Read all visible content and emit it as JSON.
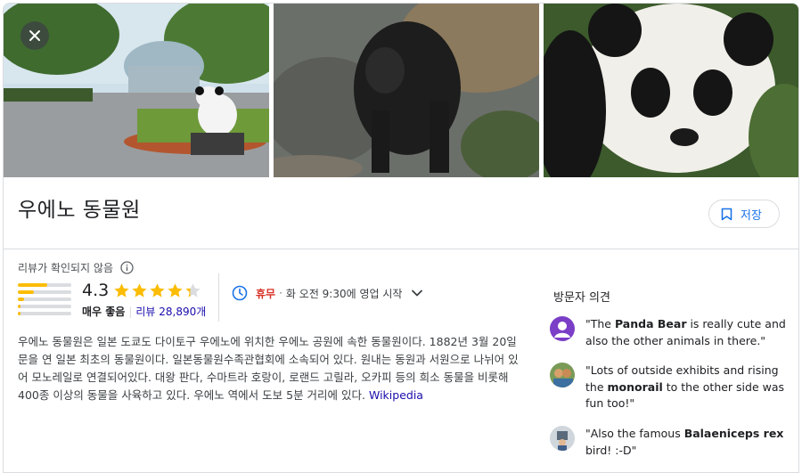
{
  "place": {
    "title": "우에노 동물원",
    "save_label": "저장",
    "close_icon": "close-icon",
    "bookmark_icon": "bookmark-icon"
  },
  "rating": {
    "unverified_label": "리뷰가 확인되지 않음",
    "score": "4.3",
    "stars": 4.3,
    "label": "매우 좋음",
    "separator": "|",
    "count_label": "리뷰 28,890개",
    "distribution": [
      0.55,
      0.3,
      0.12,
      0.05,
      0.05
    ]
  },
  "hours": {
    "status": "휴무",
    "dot": "·",
    "next_open": "화 오전 9:30에 영업 시작"
  },
  "description": {
    "text": "우에노 동물원은 일본 도쿄도 다이토구 우에노에 위치한 우에노 공원에 속한 동물원이다. 1882년 3월 20일 문을 연 일본 최초의 동물원이다. 일본동물원수족관협회에 소속되어 있다. 원내는 동원과 서원으로 나뉘어 있어 모노레일로 연결되어있다. 대왕 판다, 수마트라 호랑이, 로랜드 고릴라, 오카피 등의 희소 동물을 비롯해 400종 이상의 동물을 사육하고 있다. 우에노 역에서 도보 5분 거리에 있다.",
    "source": "Wikipedia"
  },
  "reviews": {
    "title": "방문자 의견",
    "items": [
      {
        "pre": "\"The ",
        "bold": "Panda Bear",
        "post": " is really cute and also the other animals in there.\""
      },
      {
        "pre": "\"Lots of outside exhibits and rising the ",
        "bold": "monorail",
        "post": " to the other side was fun too!\""
      },
      {
        "pre": "\"Also the famous ",
        "bold": "Balaeniceps rex",
        "post": " bird! :-D\""
      }
    ]
  },
  "colors": {
    "accent": "#1a73e8",
    "star": "#fbbc04",
    "closed": "#d93025",
    "link": "#1a0dab"
  }
}
